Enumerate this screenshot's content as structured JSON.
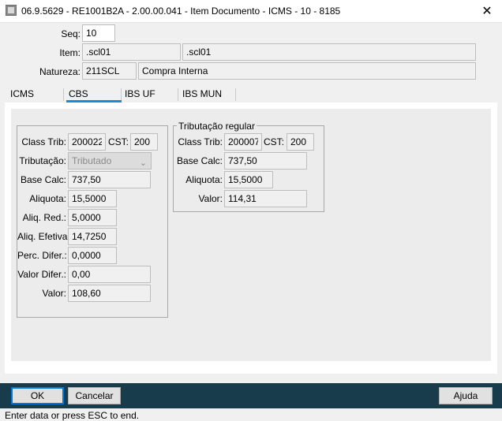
{
  "window": {
    "title": "06.9.5629 - RE1001B2A - 2.00.00.041 - Item Documento - ICMS - 10 - 8185",
    "close_glyph": "✕",
    "app_icon": "app-icon"
  },
  "header": {
    "seq_label": "Seq:",
    "seq_value": "10",
    "item_label": "Item:",
    "item_code": ".scl01",
    "item_desc": ".scl01",
    "natureza_label": "Natureza:",
    "natureza_code": "211SCL",
    "natureza_desc": "Compra Interna"
  },
  "tabs": [
    {
      "label": "ICMS",
      "active": false
    },
    {
      "label": "CBS",
      "active": true
    },
    {
      "label": "IBS UF",
      "active": false
    },
    {
      "label": "IBS MUN",
      "active": false
    }
  ],
  "cbs": {
    "class_trib_label": "Class Trib:",
    "class_trib_value": "200022",
    "cst_label": "CST:",
    "cst_value": "200",
    "tributacao_label": "Tributação:",
    "tributacao_value": "Tributado",
    "base_calc_label": "Base Calc:",
    "base_calc_value": "737,50",
    "aliquota_label": "Aliquota:",
    "aliquota_value": "15,5000",
    "aliq_red_label": "Aliq. Red.:",
    "aliq_red_value": "5,0000",
    "aliq_efetiva_label": "Aliq. Efetiva:",
    "aliq_efetiva_value": "14,7250",
    "perc_difer_label": "Perc. Difer.:",
    "perc_difer_value": "0,0000",
    "valor_difer_label": "Valor Difer.:",
    "valor_difer_value": "0,00",
    "valor_label": "Valor:",
    "valor_value": "108,60"
  },
  "tributacao_regular": {
    "legend": "Tributação regular",
    "class_trib_label": "Class Trib:",
    "class_trib_value": "200007",
    "cst_label": "CST:",
    "cst_value": "200",
    "base_calc_label": "Base Calc:",
    "base_calc_value": "737,50",
    "aliquota_label": "Aliquota:",
    "aliquota_value": "15,5000",
    "valor_label": "Valor:",
    "valor_value": "114,31"
  },
  "footer": {
    "ok_label": "OK",
    "cancel_label": "Cancelar",
    "help_label": "Ajuda"
  },
  "status": {
    "text": "Enter data or press ESC to end."
  },
  "colors": {
    "accent": "#1a8ad4",
    "footer_bg": "#183c4c",
    "panel_bg": "#ececec"
  }
}
